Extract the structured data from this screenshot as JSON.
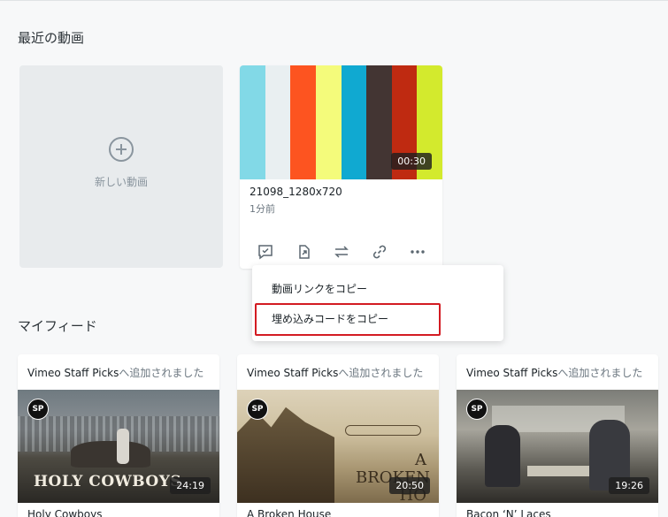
{
  "recent": {
    "title": "最近の動画",
    "new_video_label": "新しい動画",
    "video": {
      "name": "21098_1280x720",
      "time": "1分前",
      "duration": "00:30",
      "stripes": [
        "#82d9e7",
        "#e9eff1",
        "#fd5420",
        "#f4fb7b",
        "#10a9d1",
        "#433533",
        "#bf2a11",
        "#d3ea2d"
      ]
    }
  },
  "menu": {
    "copy_link": "動画リンクをコピー",
    "copy_embed": "埋め込みコードをコピー"
  },
  "feed": {
    "title": "マイフィード",
    "cards": [
      {
        "source": "Vimeo Staff Picks",
        "action": "へ追加されました",
        "badge": "SP",
        "duration": "24:19",
        "name": "Holy Cowboys",
        "poster_text": "HOLY COWBOYS"
      },
      {
        "source": "Vimeo Staff Picks",
        "action": "へ追加されました",
        "badge": "SP",
        "duration": "20:50",
        "name": "A Broken House",
        "poster_text": "A BROKEN HO"
      },
      {
        "source": "Vimeo Staff Picks",
        "action": "へ追加されました",
        "badge": "SP",
        "duration": "19:26",
        "name": "Bacon ‘N’ Laces"
      }
    ]
  }
}
